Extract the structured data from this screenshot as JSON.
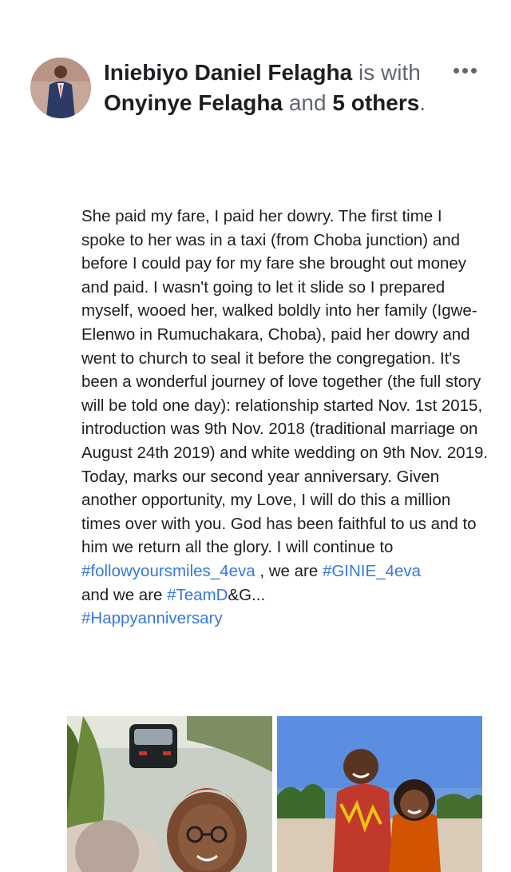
{
  "post": {
    "author": "Iniebiyo Daniel Felagha",
    "is_with": "is with",
    "tagged_person": "Onyinye Felagha",
    "and": "and",
    "others_count": "5",
    "others_word": "others",
    "period": ".",
    "more_icon": "more-horizontal-icon",
    "body_text": "She paid my fare, I paid her dowry. The first time I spoke to her was in a taxi (from Choba junction) and before I could pay for my fare she brought out money and paid. I wasn't going to let it slide so I prepared myself, wooed her, walked boldly into her family (Igwe-Elenwo in Rumuchakara, Choba), paid her dowry and went to church to seal it before the congregation. It's been a wonderful journey of love together (the full story will be told one day): relationship started Nov. 1st 2015, introduction was 9th Nov. 2018 (traditional marriage on August 24th 2019) and white wedding on 9th Nov. 2019. Today, marks our second year anniversary. Given another opportunity, my Love, I will do this a million times over with you. God has been faithful to us and to him we return all the glory. I will continue to",
    "hashtag1": "#followyoursmiles_4eva",
    "text_we_are": " , we are ",
    "hashtag2": "#GINIE_4eva",
    "text_and_we_are": "and we are ",
    "hashtag3": "#TeamD",
    "text_tail": "&G...",
    "hashtag4": "#Happyanniversary"
  },
  "colors": {
    "link": "#3578e5",
    "text": "#1c1e21",
    "muted": "#616770"
  }
}
